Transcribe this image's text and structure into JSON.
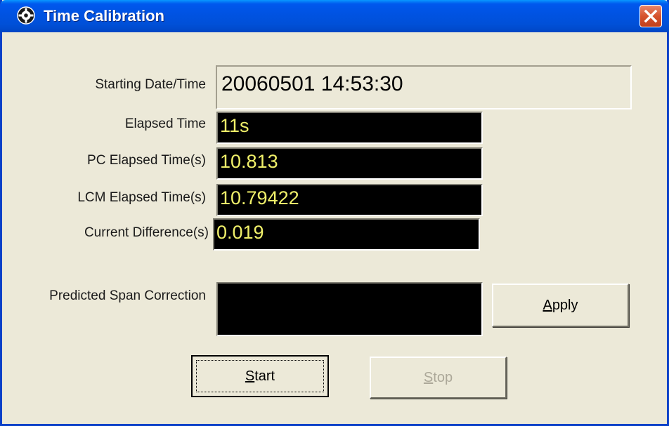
{
  "window": {
    "title": "Time Calibration",
    "icon": "clock-gear-icon"
  },
  "fields": {
    "starting_datetime": {
      "label": "Starting Date/Time",
      "value": "20060501 14:53:30"
    },
    "elapsed_time": {
      "label": "Elapsed Time",
      "value": "11s"
    },
    "pc_elapsed": {
      "label": "PC Elapsed Time(s)",
      "value": "10.813"
    },
    "lcm_elapsed": {
      "label": "LCM Elapsed Time(s)",
      "value": "10.79422"
    },
    "current_difference": {
      "label": "Current Difference(s)",
      "value": "0.019"
    },
    "predicted_span_correction": {
      "label": "Predicted Span Correction",
      "value": ""
    }
  },
  "buttons": {
    "apply": {
      "mnemonic": "A",
      "rest": "pply"
    },
    "start": {
      "mnemonic": "S",
      "rest": "tart"
    },
    "stop": {
      "mnemonic": "S",
      "rest": "top",
      "enabled": false
    }
  },
  "colors": {
    "titlebar": "#0053e3",
    "window_bg": "#ece9d8",
    "display_bg": "#000000",
    "display_text": "#f0f06a",
    "close_button": "#d6532e"
  }
}
